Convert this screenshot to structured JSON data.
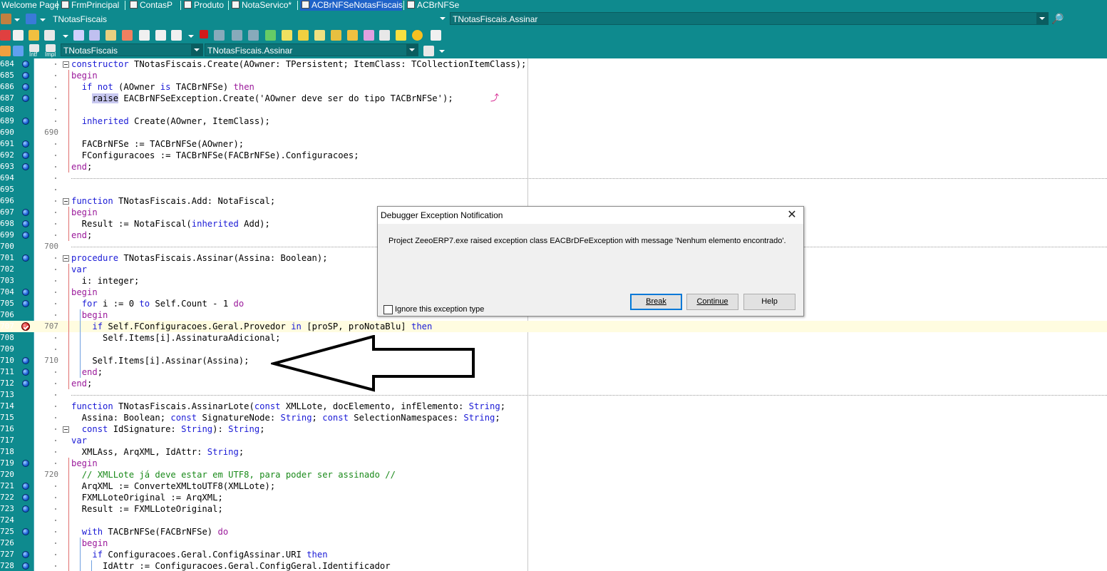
{
  "tabs": [
    {
      "label": "Welcome Page",
      "active": false
    },
    {
      "label": "FrmPrincipal",
      "active": false
    },
    {
      "label": "ContasP",
      "active": false
    },
    {
      "label": "Produto",
      "active": false
    },
    {
      "label": "NotaServico*",
      "active": false
    },
    {
      "label": "ACBrNFSeNotasFiscais",
      "active": true
    },
    {
      "label": "ACBrNFSe",
      "active": false
    }
  ],
  "toolbar": {
    "class_combo": "TNotasFiscais",
    "method_combo": "TNotasFiscais.Assinar",
    "nav_class_combo": "TNotasFiscais",
    "nav_method_combo": "TNotasFiscais.Assinar",
    "intf_label": "Intf",
    "impl_label": "Impl"
  },
  "editor": {
    "lines": [
      {
        "n": "684",
        "mark": "dot",
        "fold": "open",
        "html": "<span class=\"k\">constructor</span> TNotasFiscais.Create(AOwner: TPersistent; ItemClass: TCollectionItemClass);"
      },
      {
        "n": "685",
        "mark": "dot",
        "html": "<span class=\"b\">begin</span>"
      },
      {
        "n": "686",
        "mark": "dot",
        "html": "  <span class=\"k\">if not</span> (AOwner <span class=\"k\">is</span> TACBrNFSe) <span class=\"b\">then</span>"
      },
      {
        "n": "687",
        "mark": "dot",
        "html": "    <span class=\"hl\">raise</span> EACBrNFSeException.Create(<span class=\"s\">'AOwner deve ser do tipo TACBrNFSe'</span>);"
      },
      {
        "n": "688",
        "mark": "",
        "html": ""
      },
      {
        "n": "689",
        "mark": "dot",
        "html": "  <span class=\"k\">inherited</span> Create(AOwner, ItemClass);"
      },
      {
        "n": "690",
        "mark": "",
        "html": "",
        "m": "690"
      },
      {
        "n": "691",
        "mark": "dot",
        "html": "  FACBrNFSe := TACBrNFSe(AOwner);"
      },
      {
        "n": "692",
        "mark": "dot",
        "html": "  FConfiguracoes := TACBrNFSe(FACBrNFSe).Configuracoes;"
      },
      {
        "n": "693",
        "mark": "dot",
        "html": "<span class=\"b\">end</span>;"
      },
      {
        "n": "694",
        "mark": "",
        "html": "",
        "sep": true
      },
      {
        "n": "695",
        "mark": "",
        "html": ""
      },
      {
        "n": "696",
        "mark": "",
        "fold": "open",
        "html": "<span class=\"k\">function</span> TNotasFiscais.Add: NotaFiscal;"
      },
      {
        "n": "697",
        "mark": "dot",
        "html": "<span class=\"b\">begin</span>"
      },
      {
        "n": "698",
        "mark": "dot",
        "html": "  Result := NotaFiscal(<span class=\"k\">inherited</span> Add);"
      },
      {
        "n": "699",
        "mark": "dot",
        "html": "<span class=\"b\">end</span>;"
      },
      {
        "n": "700",
        "mark": "",
        "html": "",
        "m": "700",
        "sep": true
      },
      {
        "n": "701",
        "mark": "dot",
        "fold": "open",
        "html": "<span class=\"k\">procedure</span> TNotasFiscais.Assinar(Assina: Boolean);"
      },
      {
        "n": "702",
        "mark": "",
        "html": "<span class=\"k\">var</span>"
      },
      {
        "n": "703",
        "mark": "",
        "html": "  i: integer;"
      },
      {
        "n": "704",
        "mark": "dot",
        "html": "<span class=\"b\">begin</span>"
      },
      {
        "n": "705",
        "mark": "dot",
        "html": "  <span class=\"k\">for</span> i := 0 <span class=\"k\">to</span> Self.Count - 1 <span class=\"b\">do</span>"
      },
      {
        "n": "706",
        "mark": "",
        "html": "  <span class=\"b\">begin</span>"
      },
      {
        "n": "707",
        "mark": "bp",
        "m": "707",
        "exec": true,
        "html": "    <span class=\"k\">if</span> Self.FConfiguracoes.Geral.Provedor <span class=\"k\">in</span> [proSP, proNotaBlu] <span class=\"k\">then</span>"
      },
      {
        "n": "708",
        "mark": "",
        "html": "      Self.Items[i].AssinaturaAdicional;"
      },
      {
        "n": "709",
        "mark": "",
        "html": ""
      },
      {
        "n": "710",
        "mark": "dot",
        "m": "710",
        "html": "    Self.Items[i].Assinar(Assina);"
      },
      {
        "n": "711",
        "mark": "dot",
        "html": "  <span class=\"b\">end</span>;"
      },
      {
        "n": "712",
        "mark": "dot",
        "html": "<span class=\"b\">end</span>;"
      },
      {
        "n": "713",
        "mark": "",
        "html": "",
        "sep": true
      },
      {
        "n": "714",
        "mark": "",
        "html": "<span class=\"k\">function</span> TNotasFiscais.AssinarLote(<span class=\"k\">const</span> XMLLote, docElemento, infElemento: <span class=\"k\">String</span>;"
      },
      {
        "n": "715",
        "mark": "",
        "html": "  Assina: Boolean; <span class=\"k\">const</span> SignatureNode: <span class=\"k\">String</span>; <span class=\"k\">const</span> SelectionNamespaces: <span class=\"k\">String</span>;"
      },
      {
        "n": "716",
        "mark": "",
        "fold": "open",
        "html": "  <span class=\"k\">const</span> IdSignature: <span class=\"k\">String</span>): <span class=\"k\">String</span>;"
      },
      {
        "n": "717",
        "mark": "",
        "html": "<span class=\"k\">var</span>"
      },
      {
        "n": "718",
        "mark": "",
        "html": "  XMLAss, ArqXML, IdAttr: <span class=\"k\">String</span>;"
      },
      {
        "n": "719",
        "mark": "dot",
        "html": "<span class=\"b\">begin</span>"
      },
      {
        "n": "720",
        "mark": "",
        "m": "720",
        "html": "  <span class=\"c\">// XMLLote já deve estar em UTF8, para poder ser assinado //</span>"
      },
      {
        "n": "721",
        "mark": "dot",
        "html": "  ArqXML := ConverteXMLtoUTF8(XMLLote);"
      },
      {
        "n": "722",
        "mark": "dot",
        "html": "  FXMLLoteOriginal := ArqXML;"
      },
      {
        "n": "723",
        "mark": "dot",
        "html": "  Result := FXMLLoteOriginal;"
      },
      {
        "n": "724",
        "mark": "",
        "html": ""
      },
      {
        "n": "725",
        "mark": "dot",
        "html": "  <span class=\"k\">with</span> TACBrNFSe(FACBrNFSe) <span class=\"b\">do</span>"
      },
      {
        "n": "726",
        "mark": "",
        "html": "  <span class=\"b\">begin</span>"
      },
      {
        "n": "727",
        "mark": "dot",
        "html": "    <span class=\"k\">if</span> Configuracoes.Geral.ConfigAssinar.URI <span class=\"k\">then</span>"
      },
      {
        "n": "728",
        "mark": "dot",
        "html": "      IdAttr := Configuracoes.Geral.ConfigGeral.Identificador"
      }
    ]
  },
  "dialog": {
    "title": "Debugger Exception Notification",
    "message": "Project ZeeoERP7.exe raised exception class EACBrDFeException with message 'Nenhum elemento encontrado'.",
    "ignore_label": "Ignore this exception type",
    "break_label": "Break",
    "continue_label": "Continue",
    "help_label": "Help",
    "close_glyph": "✕"
  }
}
